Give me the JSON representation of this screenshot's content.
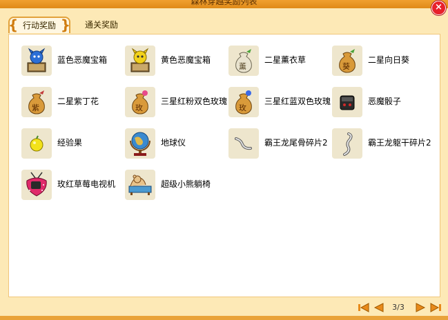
{
  "window": {
    "title": "森林穿越奖励列表",
    "close_label": "×"
  },
  "tabs": [
    {
      "label": "行动奖励",
      "active": true
    },
    {
      "label": "通关奖励",
      "active": false
    }
  ],
  "items": [
    {
      "name": "蓝色恶魔宝箱",
      "icon": "blue-demon-chest-icon"
    },
    {
      "name": "黄色恶魔宝箱",
      "icon": "yellow-demon-chest-icon"
    },
    {
      "name": "二星薰衣草",
      "icon": "lavender-seed-bag-icon",
      "glyph": "薰"
    },
    {
      "name": "二星向日葵",
      "icon": "sunflower-seed-bag-icon",
      "glyph": "葵"
    },
    {
      "name": "二星紫丁花",
      "icon": "lilac-seed-bag-icon",
      "glyph": "紫"
    },
    {
      "name": "三星红粉双色玫瑰",
      "icon": "rose-seed-bag-icon",
      "glyph": "玫"
    },
    {
      "name": "三星红蓝双色玫瑰",
      "icon": "rose-seed-bag-icon",
      "glyph": "玫"
    },
    {
      "name": "恶魔骰子",
      "icon": "demon-dice-icon"
    },
    {
      "name": "经验果",
      "icon": "experience-fruit-icon"
    },
    {
      "name": "地球仪",
      "icon": "globe-icon"
    },
    {
      "name": "霸王龙尾骨碎片2",
      "icon": "trex-tailbone-fragment-icon"
    },
    {
      "name": "霸王龙躯干碎片2",
      "icon": "trex-torso-fragment-icon"
    },
    {
      "name": "玫红草莓电视机",
      "icon": "strawberry-tv-icon"
    },
    {
      "name": "超级小熊躺椅",
      "icon": "bear-lounge-chair-icon"
    }
  ],
  "pager": {
    "current": 3,
    "total": 3,
    "text": "3/3"
  },
  "colors": {
    "accent_orange": "#e9a33a",
    "frame_bg": "#fde9b6",
    "close_red": "#e8212b"
  }
}
